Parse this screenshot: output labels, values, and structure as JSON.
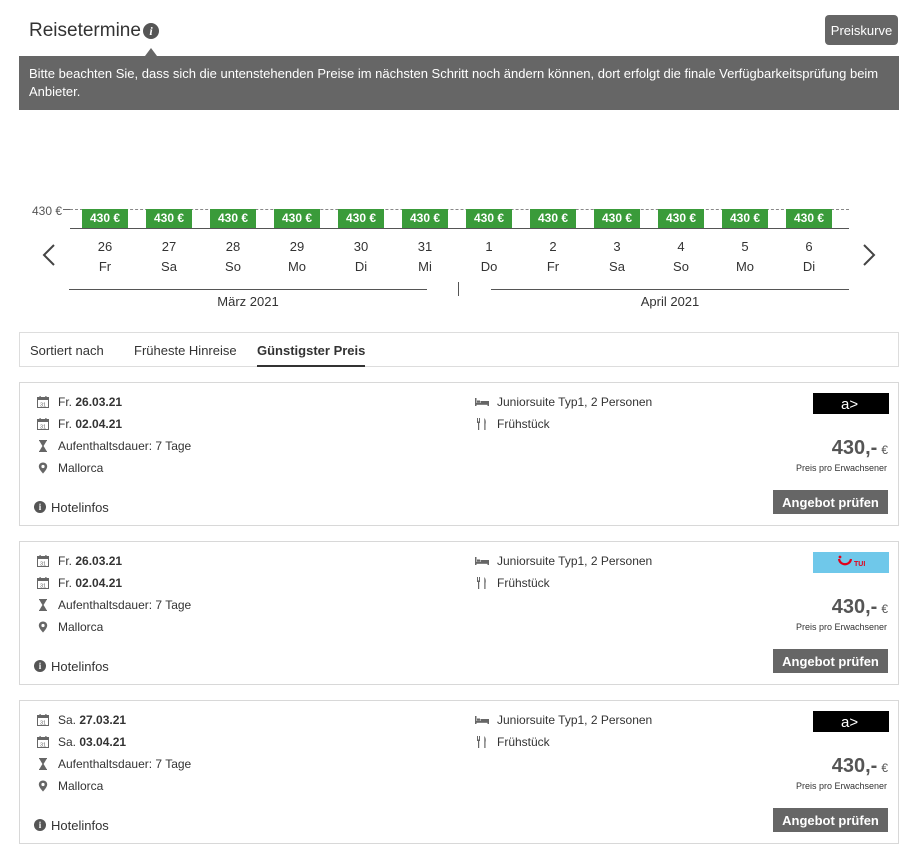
{
  "header": {
    "title": "Reisetermine",
    "info_icon": "i",
    "notice": "Bitte beachten Sie, dass sich die untenstehenden Preise im nächsten Schritt noch ändern können, dort erfolgt die finale Verfügbarkeitsprüfung beim Anbieter.",
    "preiskurve_label": "Preiskurve"
  },
  "calendar": {
    "price_axis_label": "430 €",
    "bar_color": "#3a9b3a",
    "days": [
      {
        "price": "430 €",
        "num": "26",
        "weekday": "Fr"
      },
      {
        "price": "430 €",
        "num": "27",
        "weekday": "Sa"
      },
      {
        "price": "430 €",
        "num": "28",
        "weekday": "So"
      },
      {
        "price": "430 €",
        "num": "29",
        "weekday": "Mo"
      },
      {
        "price": "430 €",
        "num": "30",
        "weekday": "Di"
      },
      {
        "price": "430 €",
        "num": "31",
        "weekday": "Mi"
      },
      {
        "price": "430 €",
        "num": "1",
        "weekday": "Do"
      },
      {
        "price": "430 €",
        "num": "2",
        "weekday": "Fr"
      },
      {
        "price": "430 €",
        "num": "3",
        "weekday": "Sa"
      },
      {
        "price": "430 €",
        "num": "4",
        "weekday": "So"
      },
      {
        "price": "430 €",
        "num": "5",
        "weekday": "Mo"
      },
      {
        "price": "430 €",
        "num": "6",
        "weekday": "Di"
      }
    ],
    "months": [
      "März 2021",
      "April 2021"
    ]
  },
  "sort": {
    "label": "Sortiert nach",
    "options": [
      "Früheste Hinreise",
      "Günstigster Preis"
    ],
    "active": "Günstigster Preis"
  },
  "offers": [
    {
      "out_day": "Fr.",
      "out_date": "26.03.21",
      "back_day": "Fr.",
      "back_date": "02.04.21",
      "duration": "Aufenthaltsdauer: 7 Tage",
      "destination": "Mallorca",
      "room": "Juniorsuite Typ1, 2 Personen",
      "board": "Frühstück",
      "operator": "alltours",
      "logo_text": "a>",
      "price": "430,-",
      "currency": "€",
      "price_note": "Preis pro Erwachsener",
      "hotelinfo": "Hotelinfos",
      "button": "Angebot prüfen"
    },
    {
      "out_day": "Fr.",
      "out_date": "26.03.21",
      "back_day": "Fr.",
      "back_date": "02.04.21",
      "duration": "Aufenthaltsdauer: 7 Tage",
      "destination": "Mallorca",
      "room": "Juniorsuite Typ1, 2 Personen",
      "board": "Frühstück",
      "operator": "tui",
      "logo_text": "TUI",
      "price": "430,-",
      "currency": "€",
      "price_note": "Preis pro Erwachsener",
      "hotelinfo": "Hotelinfos",
      "button": "Angebot prüfen"
    },
    {
      "out_day": "Sa.",
      "out_date": "27.03.21",
      "back_day": "Sa.",
      "back_date": "03.04.21",
      "duration": "Aufenthaltsdauer: 7 Tage",
      "destination": "Mallorca",
      "room": "Juniorsuite Typ1, 2 Personen",
      "board": "Frühstück",
      "operator": "alltours",
      "logo_text": "a>",
      "price": "430,-",
      "currency": "€",
      "price_note": "Preis pro Erwachsener",
      "hotelinfo": "Hotelinfos",
      "button": "Angebot prüfen"
    }
  ]
}
